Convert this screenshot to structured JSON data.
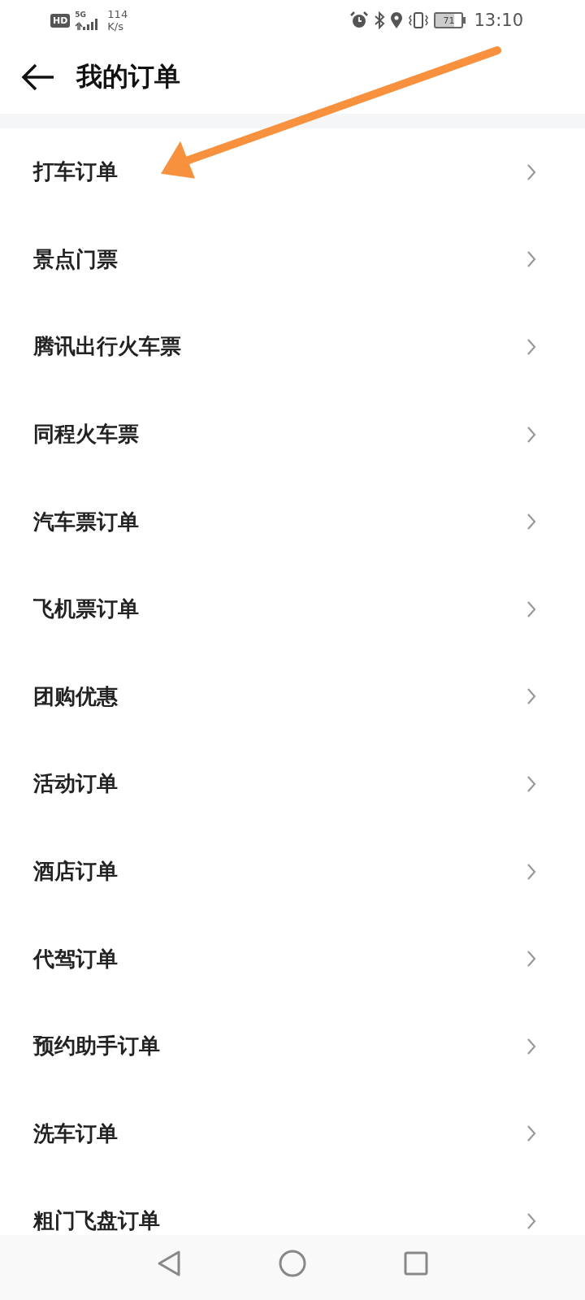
{
  "status_bar": {
    "hd": "HD",
    "network": "5G",
    "speed_value": "114",
    "speed_unit": "K/s",
    "battery": "71",
    "time": "13:10"
  },
  "header": {
    "title": "我的订单"
  },
  "orders": [
    {
      "label": "打车订单"
    },
    {
      "label": "景点门票"
    },
    {
      "label": "腾讯出行火车票"
    },
    {
      "label": "同程火车票"
    },
    {
      "label": "汽车票订单"
    },
    {
      "label": "飞机票订单"
    },
    {
      "label": "团购优惠"
    },
    {
      "label": "活动订单"
    },
    {
      "label": "酒店订单"
    },
    {
      "label": "代驾订单"
    },
    {
      "label": "预约助手订单"
    },
    {
      "label": "洗车订单"
    },
    {
      "label": "粗门飞盘订单"
    }
  ],
  "annotation": {
    "kind": "arrow",
    "color": "#f7913d"
  }
}
